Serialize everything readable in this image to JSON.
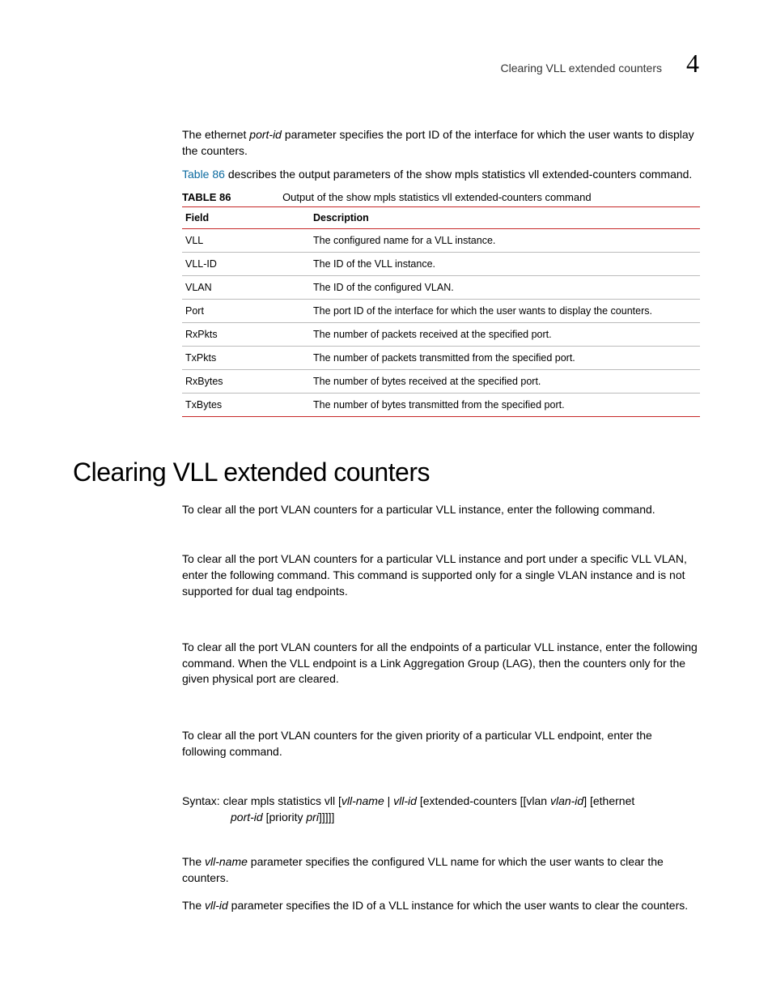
{
  "header": {
    "running_title": "Clearing VLL extended counters",
    "chapter_number": "4"
  },
  "intro": {
    "p1_pre": "The ethernet ",
    "p1_em": "port-id",
    "p1_post": " parameter specifies the port ID of the interface for which the user wants to display the counters.",
    "p2_link": "Table 86",
    "p2_post": " describes the output parameters of the show mpls statistics vll extended-counters command."
  },
  "table": {
    "label": "TABLE 86",
    "title": "Output of the show mpls statistics vll extended-counters command",
    "columns": {
      "field": "Field",
      "description": "Description"
    },
    "rows": [
      {
        "field": "VLL",
        "description": "The configured name for a VLL instance."
      },
      {
        "field": "VLL-ID",
        "description": "The ID of the VLL instance."
      },
      {
        "field": "VLAN",
        "description": "The ID of the configured VLAN."
      },
      {
        "field": "Port",
        "description": "The port ID of the interface for which the user wants to display the counters."
      },
      {
        "field": "RxPkts",
        "description": "The number of packets received at the specified port."
      },
      {
        "field": "TxPkts",
        "description": "The number of packets transmitted from the specified port."
      },
      {
        "field": "RxBytes",
        "description": "The number of bytes received at the specified port."
      },
      {
        "field": "TxBytes",
        "description": "The number of bytes transmitted from the specified port."
      }
    ]
  },
  "section_heading": "Clearing VLL extended counters",
  "paras": {
    "p1": "To clear all the port VLAN counters for a particular VLL instance, enter the following command.",
    "p2": "To clear all the port VLAN counters for a particular VLL instance and port under a specific VLL VLAN, enter the following command. This command is supported only for a single VLAN instance and is not supported for dual tag endpoints.",
    "p3": "To clear all the port VLAN counters for all the endpoints of a particular VLL instance, enter the following command. When the VLL endpoint is a Link Aggregation Group (LAG), then the counters only for the given physical port are cleared.",
    "p4": "To clear all the port VLAN counters for the given priority of a particular VLL endpoint, enter the following command."
  },
  "syntax": {
    "label": "Syntax:",
    "line1_pre": "  clear mpls statistics vll [",
    "vll_name": "vll-name",
    "sep1": " | ",
    "vll_id": "vll-id",
    "line1_mid": " [extended-counters  [[vlan ",
    "vlan_id": "vlan-id",
    "line1_post": "] [ethernet",
    "line2_pre": "",
    "port_id": "port-id",
    "line2_mid": " [priority ",
    "pri": "pri",
    "line2_post": "]]]]]"
  },
  "tail": {
    "p1_pre": "The ",
    "p1_em": "vll-name",
    "p1_post": " parameter specifies the configured VLL name for which the user wants to clear the counters.",
    "p2_pre": "The ",
    "p2_em": "vll-id",
    "p2_post": " parameter specifies the ID of a VLL instance for which the user wants to clear the counters."
  }
}
